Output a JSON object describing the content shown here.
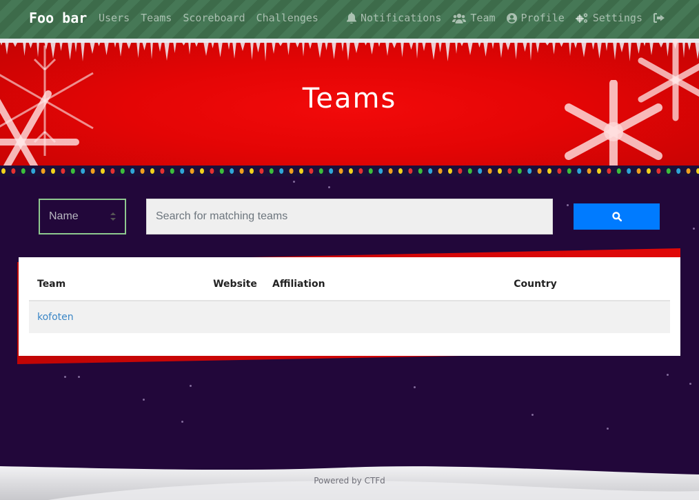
{
  "navbar": {
    "brand": "Foo bar",
    "left_links": [
      {
        "label": "Users"
      },
      {
        "label": "Teams"
      },
      {
        "label": "Scoreboard"
      },
      {
        "label": "Challenges"
      }
    ],
    "right_links": [
      {
        "label": "Notifications",
        "icon": "bell-icon"
      },
      {
        "label": "Team",
        "icon": "users-icon"
      },
      {
        "label": "Profile",
        "icon": "user-circle-icon"
      },
      {
        "label": "Settings",
        "icon": "cogs-icon"
      },
      {
        "label": "",
        "icon": "logout-icon"
      }
    ]
  },
  "hero": {
    "title": "Teams"
  },
  "search": {
    "field_selected": "Name",
    "placeholder": "Search for matching teams",
    "value": "",
    "button_icon": "search-icon"
  },
  "table": {
    "columns": [
      "Team",
      "Website",
      "Affiliation",
      "Country"
    ],
    "rows": [
      {
        "team": "kofoten",
        "website": "",
        "affiliation": "",
        "country": ""
      }
    ]
  },
  "footer": {
    "prefix": "Powered by ",
    "link": "CTFd"
  },
  "colors": {
    "navbar_stripe_dark": "#3d6b4a",
    "navbar_stripe_light": "#467856",
    "hero_red": "#e40505",
    "page_bg": "#22073a",
    "search_button": "#007bff",
    "select_border": "#8fc98f",
    "team_link": "#3a86c6"
  }
}
